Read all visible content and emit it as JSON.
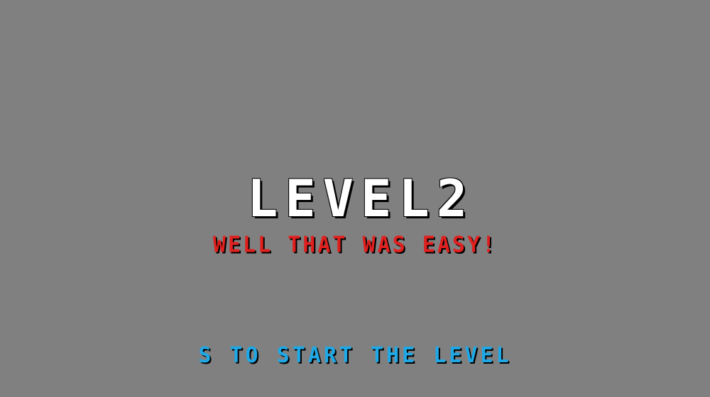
{
  "screen": {
    "level_title": "LEVEL2",
    "subtitle": "WELL THAT WAS EASY!",
    "start_prompt": "S TO START THE LEVEL"
  },
  "colors": {
    "background": "#808080",
    "title": "#ffffff",
    "subtitle": "#e0201e",
    "prompt": "#1ea8e6"
  }
}
